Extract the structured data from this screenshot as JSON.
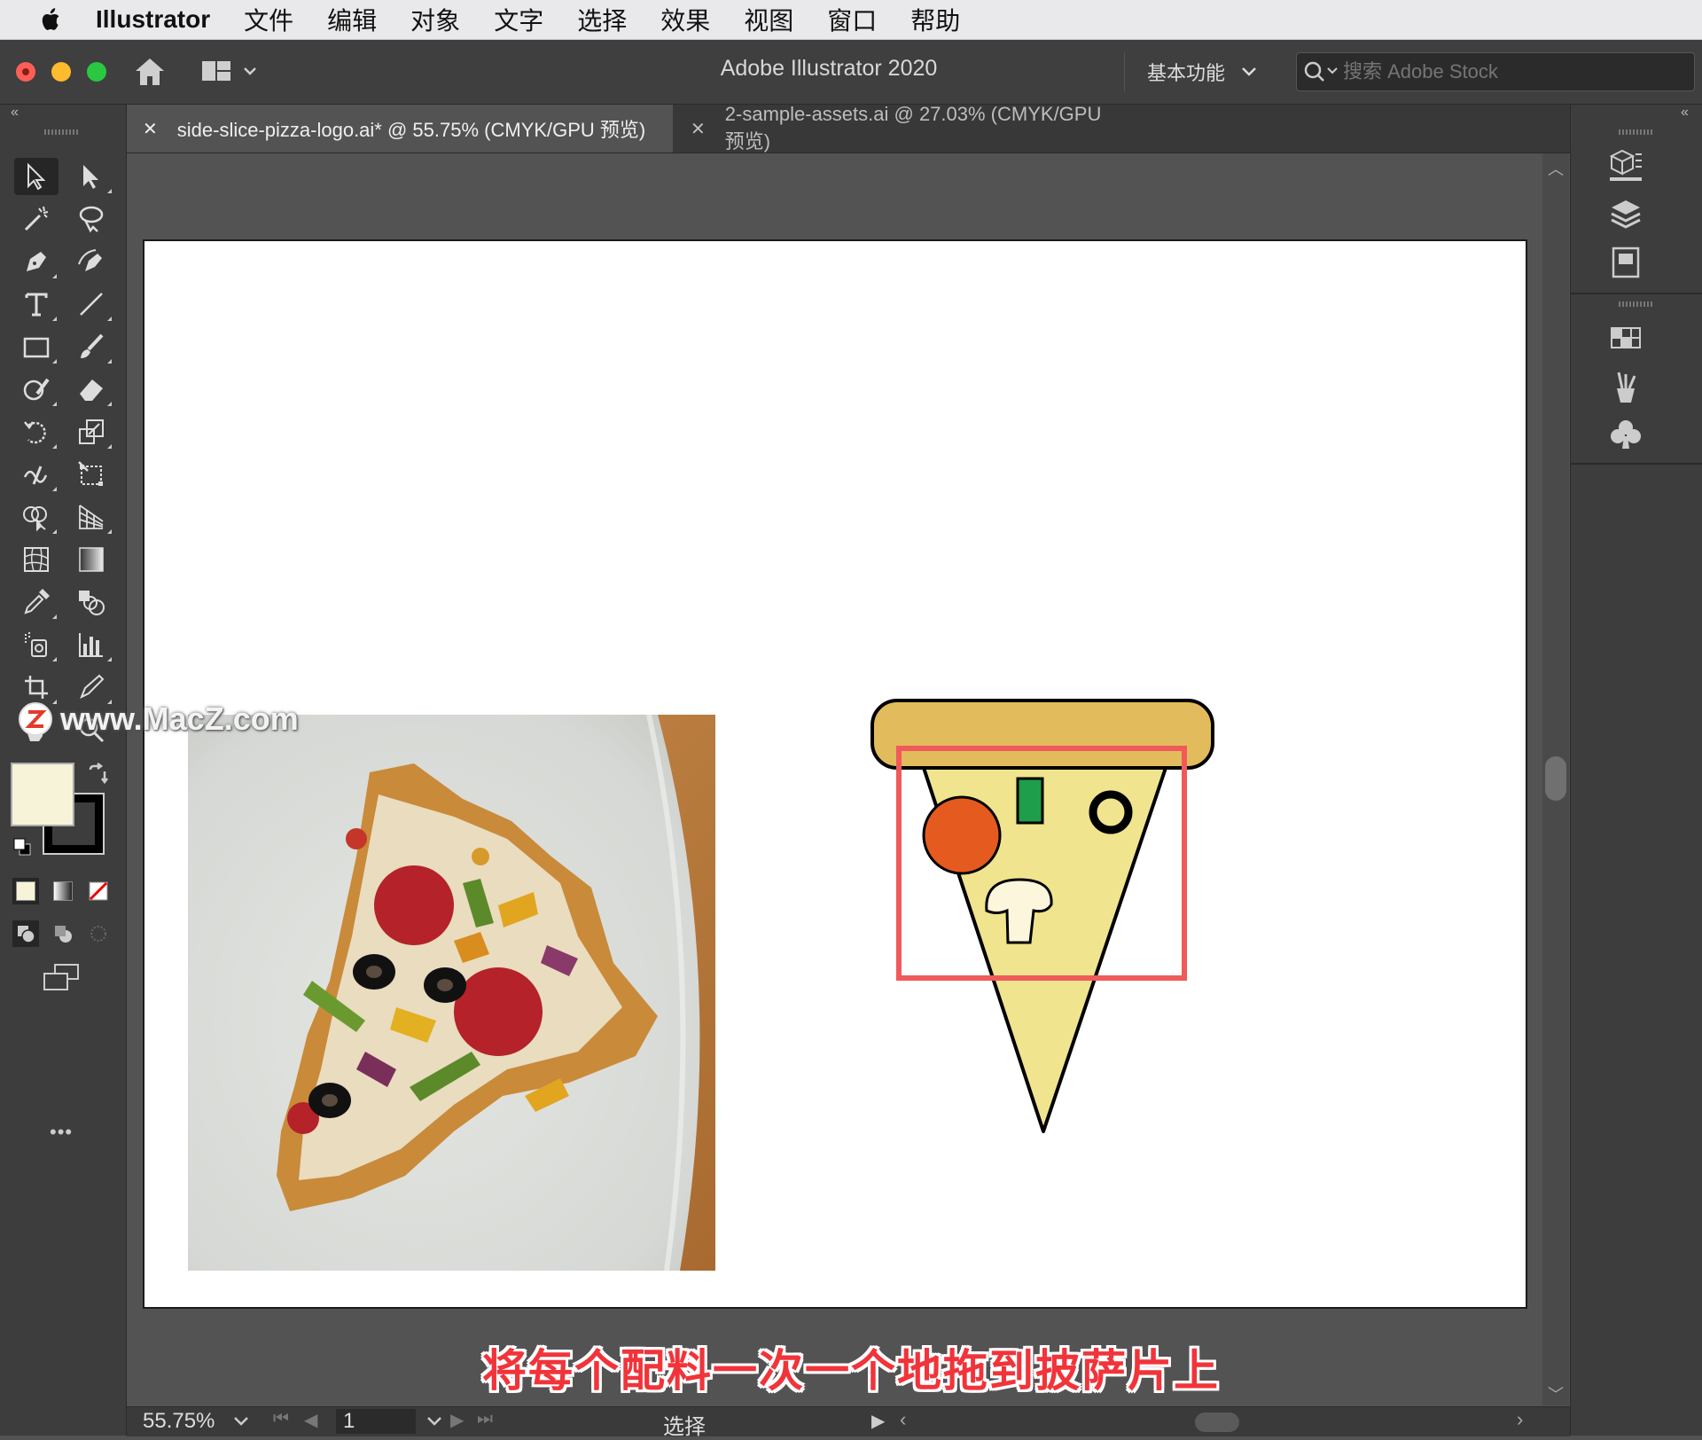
{
  "menubar": {
    "app_name": "Illustrator",
    "items": [
      "文件",
      "编辑",
      "对象",
      "文字",
      "选择",
      "效果",
      "视图",
      "窗口",
      "帮助"
    ]
  },
  "titlebar": {
    "title": "Adobe Illustrator 2020",
    "workspace": "基本功能",
    "search_placeholder": "搜索 Adobe Stock"
  },
  "tabs": [
    {
      "label": "side-slice-pizza-logo.ai* @ 55.75% (CMYK/GPU 预览)",
      "active": true
    },
    {
      "label": "2-sample-assets.ai @ 27.03% (CMYK/GPU 预览)",
      "active": false
    }
  ],
  "toolbar": {
    "fill_color": "#f7f3d8",
    "stroke_color": "#000000",
    "more_label": "•••"
  },
  "canvas": {
    "watermark": "www.MacZ.com",
    "caption": "将每个配料一次一个地拖到披萨片上",
    "highlight_color": "#f05a5a"
  },
  "statusbar": {
    "zoom": "55.75%",
    "artboard": "1",
    "state": "选择"
  },
  "colors": {
    "crust": "#e2bb5c",
    "slice": "#f0e48e",
    "pepperoni": "#e55a1f",
    "pepper": "#1e9d4a",
    "mushroom": "#fbf6dc"
  }
}
